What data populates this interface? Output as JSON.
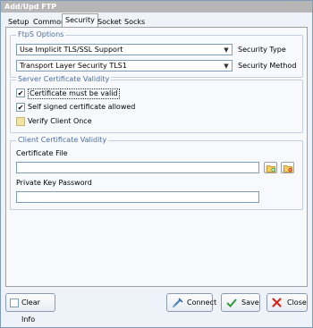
{
  "window": {
    "title": "Add/Upd FTP"
  },
  "tabs": [
    {
      "label": "Setup",
      "active": false
    },
    {
      "label": "Common",
      "active": false
    },
    {
      "label": "Security",
      "active": true
    },
    {
      "label": "Socket",
      "active": false
    },
    {
      "label": "Socks",
      "active": false
    }
  ],
  "ftps_options": {
    "group_label": "FtpS Options",
    "security_type": {
      "value": "Use Implicit TLS/SSL Support",
      "label": "Security Type"
    },
    "security_method": {
      "value": "Transport Layer Security TLS1",
      "label": "Security Method"
    }
  },
  "server_cert": {
    "group_label": "Server Certificate Validity",
    "must_be_valid": {
      "label": "Certificate must be valid",
      "checked": true
    },
    "self_signed": {
      "label": "Self signed certificate allowed",
      "checked": true
    },
    "verify_client": {
      "label": "Verify Client Once",
      "checked": false
    }
  },
  "client_cert": {
    "group_label": "Client Certificate Validity",
    "cert_file_label": "Certificate File",
    "cert_file_value": "",
    "private_key_label": "Private Key Password",
    "private_key_value": ""
  },
  "buttons": {
    "clear_info": "Clear Info",
    "connect": "Connect",
    "save": "Save",
    "close": "Close"
  },
  "colors": {
    "accent": "#4d6fa1",
    "panel": "#f7f9fc",
    "border": "#7f9db9"
  },
  "icons": [
    "folder-open-icon",
    "folder-delete-icon",
    "connect-icon",
    "save-check-icon",
    "close-x-icon",
    "checkmark-icon",
    "dropdown-arrow-icon"
  ]
}
